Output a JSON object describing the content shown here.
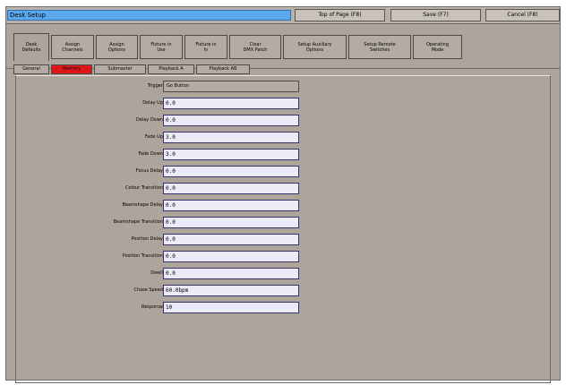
{
  "window": {
    "title": "Desk Setup",
    "buttons": {
      "top_of_page": "Top of Page (F8)",
      "save": "Save (F7)",
      "cancel": "Cancel (F8)"
    }
  },
  "main_tabs": [
    {
      "label": "Desk\nDefaults"
    },
    {
      "label": "Assign\nChannels"
    },
    {
      "label": "Assign\nOptions"
    },
    {
      "label": "Fixture in\nUse"
    },
    {
      "label": "Fixture in\nIn"
    },
    {
      "label": "Clear\nDMX Patch"
    },
    {
      "label": "Setup Auxiliary\nOptions"
    },
    {
      "label": "Setup Remote\nSwitches"
    },
    {
      "label": "Operating\nMode"
    }
  ],
  "sub_tabs": [
    {
      "label": "General"
    },
    {
      "label": "Memory"
    },
    {
      "label": "Submaster"
    },
    {
      "label": "Playback A"
    },
    {
      "label": "Playback AB"
    }
  ],
  "form": {
    "trigger": {
      "label": "Trigger",
      "value": "Go Button"
    },
    "fields": [
      {
        "label": "Delay Up",
        "value": "0.0"
      },
      {
        "label": "Delay Down",
        "value": "0.0"
      },
      {
        "label": "Fade Up",
        "value": "3.0"
      },
      {
        "label": "Fade Down",
        "value": "3.0"
      },
      {
        "label": "Focus Delay",
        "value": "0.0"
      },
      {
        "label": "Colour Transition",
        "value": "0.0"
      },
      {
        "label": "Beamshape Delay",
        "value": "0.0"
      },
      {
        "label": "Beamshape Transition",
        "value": "0.0"
      },
      {
        "label": "Position Delay",
        "value": "0.0"
      },
      {
        "label": "Position Transition",
        "value": "0.0"
      },
      {
        "label": "Dwell",
        "value": "0.0"
      },
      {
        "label": "Chase Speed",
        "value": "60.0bpm"
      },
      {
        "label": "Response",
        "value": "10"
      }
    ]
  },
  "colors": {
    "active_subtab": "#e0161a",
    "title_bar": "#5ca8ee",
    "panel": "#ada59c"
  }
}
